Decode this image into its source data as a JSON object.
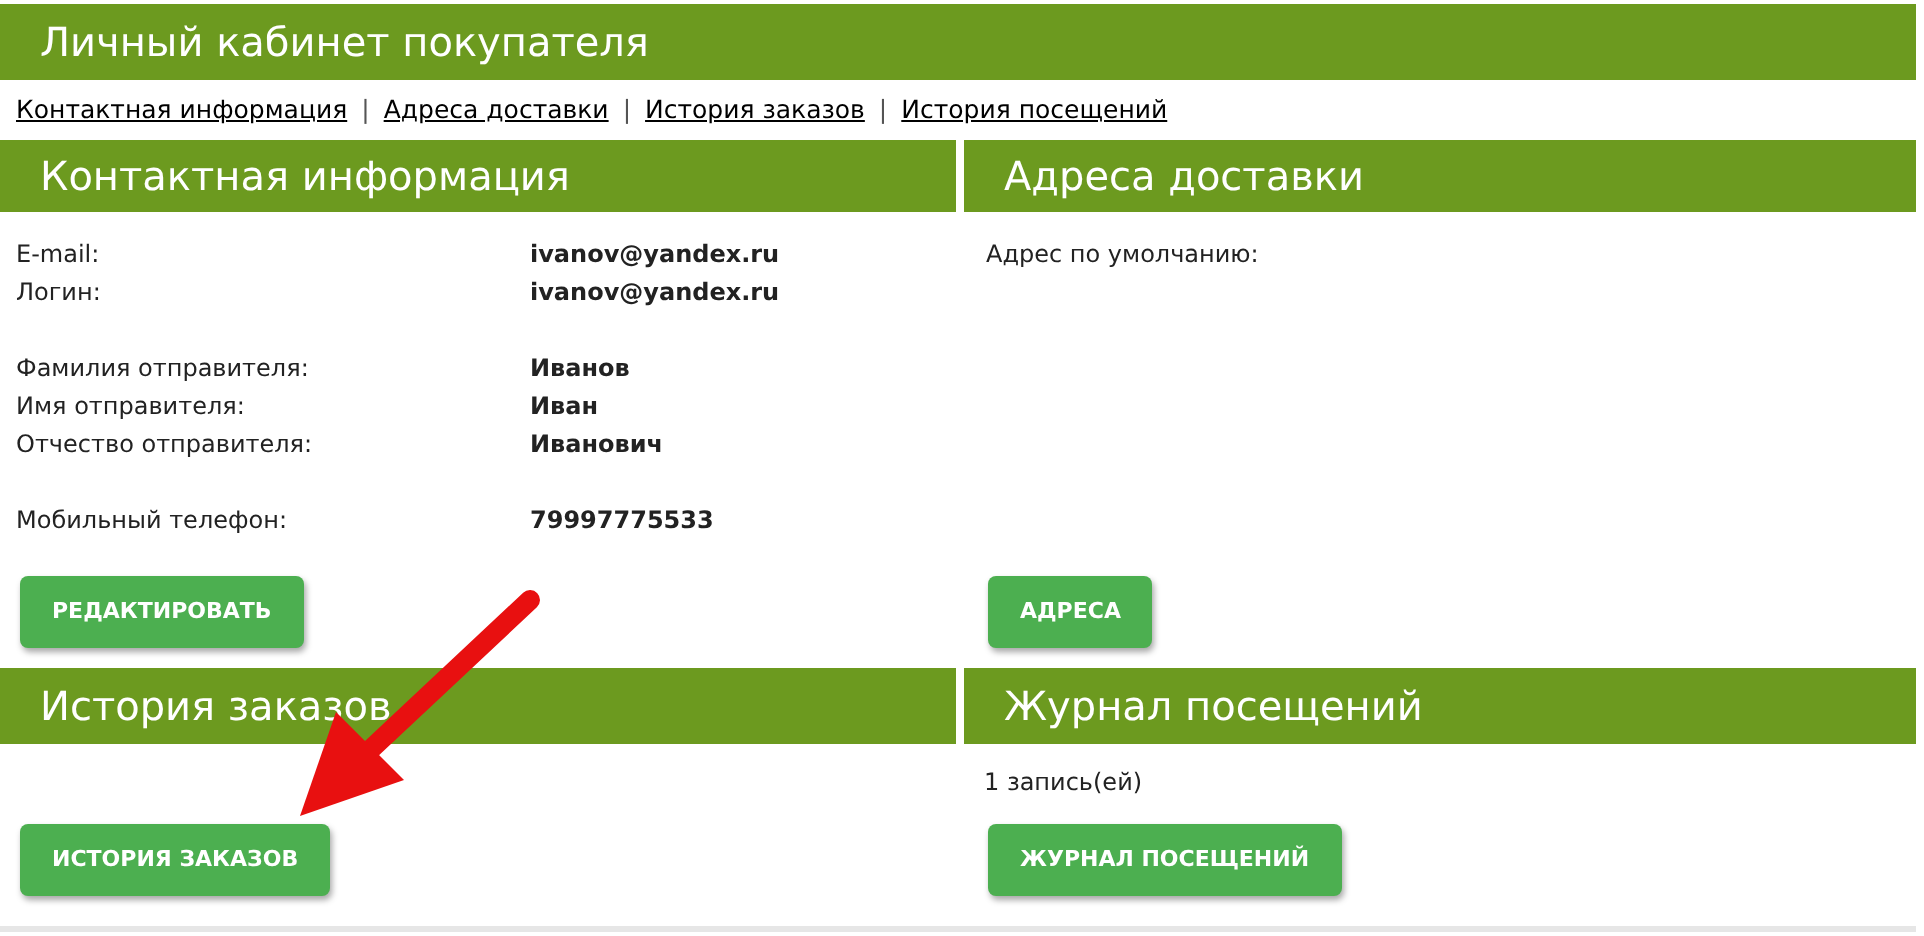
{
  "page_title": "Личный кабинет покупателя",
  "nav_links": [
    {
      "label": "Контактная информация"
    },
    {
      "label": "Адреса доставки"
    },
    {
      "label": "История заказов"
    },
    {
      "label": "История посещений"
    }
  ],
  "nav_separator": "|",
  "contact": {
    "title": "Контактная информация",
    "groups": [
      [
        {
          "label": "E-mail:",
          "value": "ivanov@yandex.ru"
        },
        {
          "label": "Логин:",
          "value": "ivanov@yandex.ru"
        }
      ],
      [
        {
          "label": "Фамилия отправителя:",
          "value": "Иванов"
        },
        {
          "label": "Имя отправителя:",
          "value": "Иван"
        },
        {
          "label": "Отчество отправителя:",
          "value": "Иванович"
        }
      ],
      [
        {
          "label": "Мобильный телефон:",
          "value": "79997775533"
        }
      ]
    ],
    "button": "РЕДАКТИРОВАТЬ"
  },
  "addresses": {
    "title": "Адреса доставки",
    "text": "Адрес по умолчанию:",
    "button": "АДРЕСА"
  },
  "orders": {
    "title": "История заказов",
    "button": "ИСТОРИЯ ЗАКАЗОВ"
  },
  "visits": {
    "title": "Журнал посещений",
    "text": "1 запись(ей)",
    "button": "ЖУРНАЛ ПОСЕЩЕНИЙ"
  }
}
